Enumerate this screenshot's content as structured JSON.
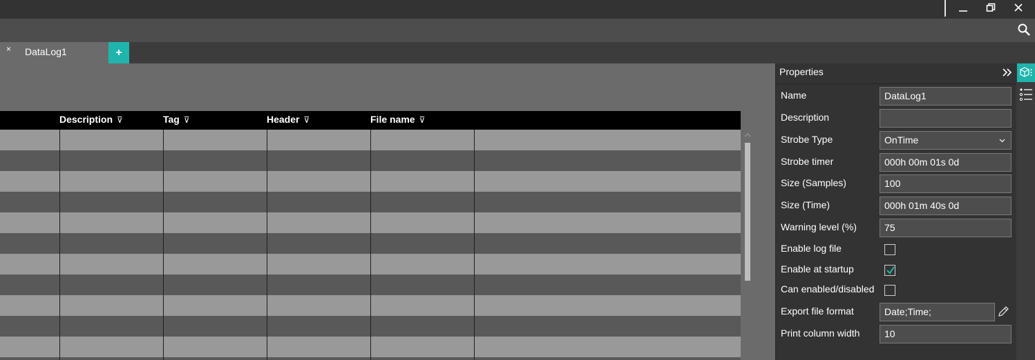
{
  "window": {
    "minimize_icon": "minimize-icon",
    "restore_icon": "restore-icon",
    "close_icon": "close-icon"
  },
  "toolbar": {
    "search_icon": "search-icon"
  },
  "tabs": [
    {
      "label": "DataLog1",
      "close": "×"
    }
  ],
  "tab_add": "+",
  "grid": {
    "columns": [
      {
        "label": "Description",
        "filter": "⊽"
      },
      {
        "label": "Tag",
        "filter": "⊽"
      },
      {
        "label": "Header",
        "filter": "⊽"
      },
      {
        "label": "File name",
        "filter": "⊽"
      }
    ],
    "row_count": 12
  },
  "properties": {
    "title": "Properties",
    "items": [
      {
        "label": "Name",
        "value": "DataLog1",
        "type": "text"
      },
      {
        "label": "Description",
        "value": "",
        "type": "text"
      },
      {
        "label": "Strobe Type",
        "value": "OnTime",
        "type": "select"
      },
      {
        "label": "Strobe timer",
        "value": "000h 00m 01s 0d",
        "type": "text"
      },
      {
        "label": "Size (Samples)",
        "value": "100",
        "type": "text"
      },
      {
        "label": "Size (Time)",
        "value": "000h 01m 40s 0d",
        "type": "text"
      },
      {
        "label": "Warning level (%)",
        "value": "75",
        "type": "text"
      },
      {
        "label": "Enable log file",
        "checked": false,
        "type": "checkbox"
      },
      {
        "label": "Enable at startup",
        "checked": true,
        "type": "checkbox"
      },
      {
        "label": "Can enabled/disabled",
        "checked": false,
        "type": "checkbox"
      },
      {
        "label": "Export file format",
        "value": "Date;Time;",
        "type": "text-edit"
      },
      {
        "label": "Print column width",
        "value": "10",
        "type": "text"
      }
    ]
  },
  "colors": {
    "accent": "#1fb5ad",
    "titlebar": "#333333",
    "toolbar": "#4d4d4d",
    "row_light": "#999999",
    "row_dark": "#595959"
  }
}
